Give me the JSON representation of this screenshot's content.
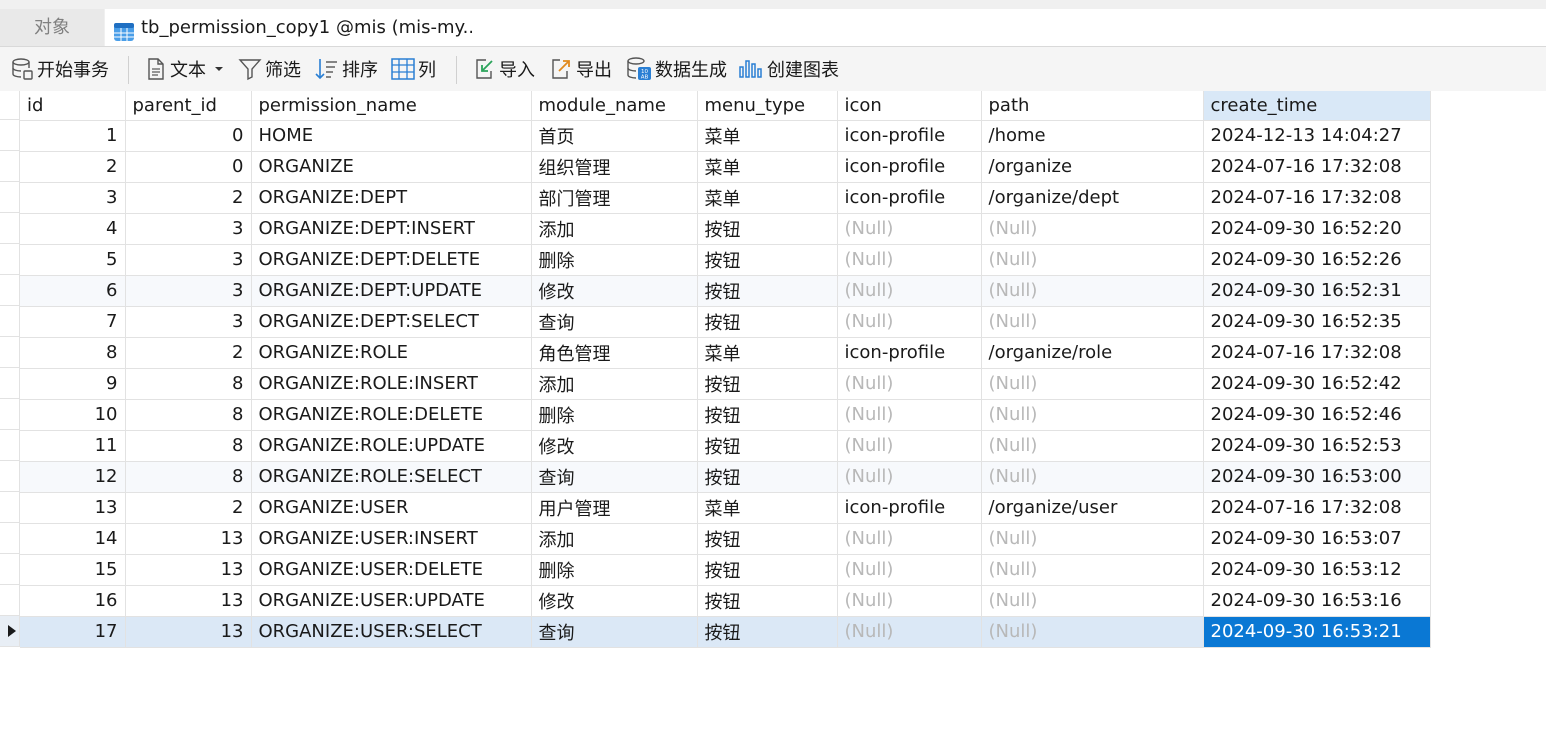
{
  "tabs": {
    "objects_label": "对象",
    "active_label": "tb_permission_copy1 @mis (mis-my..."
  },
  "toolbar": {
    "begin_transaction": "开始事务",
    "text": "文本",
    "filter": "筛选",
    "sort": "排序",
    "columns": "列",
    "import": "导入",
    "export": "导出",
    "data_generation": "数据生成",
    "create_chart": "创建图表"
  },
  "grid": {
    "columns": [
      "id",
      "parent_id",
      "permission_name",
      "module_name",
      "menu_type",
      "icon",
      "path",
      "create_time"
    ],
    "sorted_column": "create_time",
    "null_text": "(Null)",
    "selected_row": 17,
    "rows": [
      [
        "1",
        "0",
        "HOME",
        "首页",
        "菜单",
        "icon-profile",
        "/home",
        "2024-12-13 14:04:27"
      ],
      [
        "2",
        "0",
        "ORGANIZE",
        "组织管理",
        "菜单",
        "icon-profile",
        "/organize",
        "2024-07-16 17:32:08"
      ],
      [
        "3",
        "2",
        "ORGANIZE:DEPT",
        "部门管理",
        "菜单",
        "icon-profile",
        "/organize/dept",
        "2024-07-16 17:32:08"
      ],
      [
        "4",
        "3",
        "ORGANIZE:DEPT:INSERT",
        "添加",
        "按钮",
        null,
        null,
        "2024-09-30 16:52:20"
      ],
      [
        "5",
        "3",
        "ORGANIZE:DEPT:DELETE",
        "删除",
        "按钮",
        null,
        null,
        "2024-09-30 16:52:26"
      ],
      [
        "6",
        "3",
        "ORGANIZE:DEPT:UPDATE",
        "修改",
        "按钮",
        null,
        null,
        "2024-09-30 16:52:31"
      ],
      [
        "7",
        "3",
        "ORGANIZE:DEPT:SELECT",
        "查询",
        "按钮",
        null,
        null,
        "2024-09-30 16:52:35"
      ],
      [
        "8",
        "2",
        "ORGANIZE:ROLE",
        "角色管理",
        "菜单",
        "icon-profile",
        "/organize/role",
        "2024-07-16 17:32:08"
      ],
      [
        "9",
        "8",
        "ORGANIZE:ROLE:INSERT",
        "添加",
        "按钮",
        null,
        null,
        "2024-09-30 16:52:42"
      ],
      [
        "10",
        "8",
        "ORGANIZE:ROLE:DELETE",
        "删除",
        "按钮",
        null,
        null,
        "2024-09-30 16:52:46"
      ],
      [
        "11",
        "8",
        "ORGANIZE:ROLE:UPDATE",
        "修改",
        "按钮",
        null,
        null,
        "2024-09-30 16:52:53"
      ],
      [
        "12",
        "8",
        "ORGANIZE:ROLE:SELECT",
        "查询",
        "按钮",
        null,
        null,
        "2024-09-30 16:53:00"
      ],
      [
        "13",
        "2",
        "ORGANIZE:USER",
        "用户管理",
        "菜单",
        "icon-profile",
        "/organize/user",
        "2024-07-16 17:32:08"
      ],
      [
        "14",
        "13",
        "ORGANIZE:USER:INSERT",
        "添加",
        "按钮",
        null,
        null,
        "2024-09-30 16:53:07"
      ],
      [
        "15",
        "13",
        "ORGANIZE:USER:DELETE",
        "删除",
        "按钮",
        null,
        null,
        "2024-09-30 16:53:12"
      ],
      [
        "16",
        "13",
        "ORGANIZE:USER:UPDATE",
        "修改",
        "按钮",
        null,
        null,
        "2024-09-30 16:53:16"
      ],
      [
        "17",
        "13",
        "ORGANIZE:USER:SELECT",
        "查询",
        "按钮",
        null,
        null,
        "2024-09-30 16:53:21"
      ]
    ]
  },
  "colors": {
    "selected_cell_bg": "#0a78d4",
    "selected_row_bg": "#dbe8f6",
    "sorted_header_bg": "#d9e8f7",
    "null_text": "#b8b8b8"
  }
}
